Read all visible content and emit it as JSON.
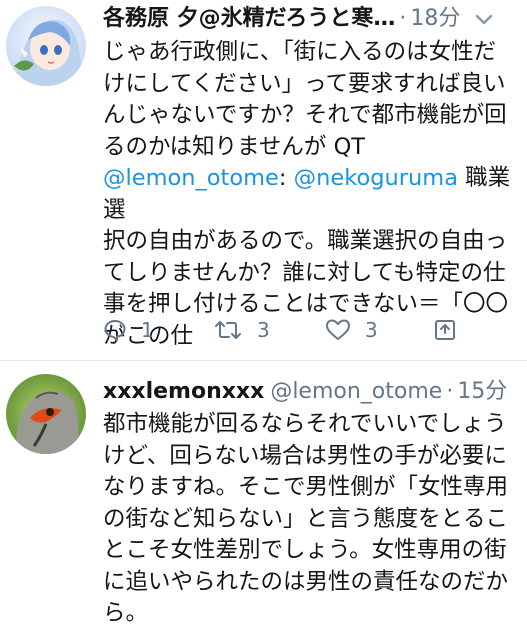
{
  "tweets": [
    {
      "display_name": "各務原 夕@氷精だろうと寒…",
      "handle": "",
      "time": "18分",
      "lines": [
        "じゃあ行政側に、「街に入るのは女性だ",
        "けにしてください」って要求すれば良い",
        "んじゃないですか？それで都市機能が回",
        "るのかは知りませんが QT"
      ],
      "quote_mention_1": "@lemon_otome",
      "quote_sep": ": ",
      "quote_mention_2": "@nekoguruma",
      "quote_lines": [
        " 職業選",
        "択の自由があるので。職業選択の自由っ",
        "てしりませんか？誰に対しても特定の仕",
        "事を押し付けることはできない＝「〇〇",
        "がこの仕"
      ],
      "reply_count": "1",
      "retweet_count": "3",
      "like_count": "3",
      "icons": {
        "reply": "reply-icon",
        "retweet": "retweet-icon",
        "like": "heart-icon",
        "share": "share-icon",
        "menu": "chevron-down-icon"
      }
    },
    {
      "display_name": "xxxlemonxxx",
      "handle": "@lemon_otome",
      "time": "15分",
      "lines": [
        "都市機能が回るならそれでいいでしょう",
        "けど、回らない場合は男性の手が必要に",
        "なりますね。そこで男性側が「女性専用",
        "の街など知らない」と言う態度をとるこ",
        "とこそ女性差別でしょう。女性専用の街",
        "に追いやられたのは男性の責任なのだか",
        "ら。"
      ]
    }
  ],
  "colors": {
    "accent": "#1b95e0",
    "secondary": "#657786",
    "text": "#14171a",
    "divider": "#e1e8ed"
  }
}
